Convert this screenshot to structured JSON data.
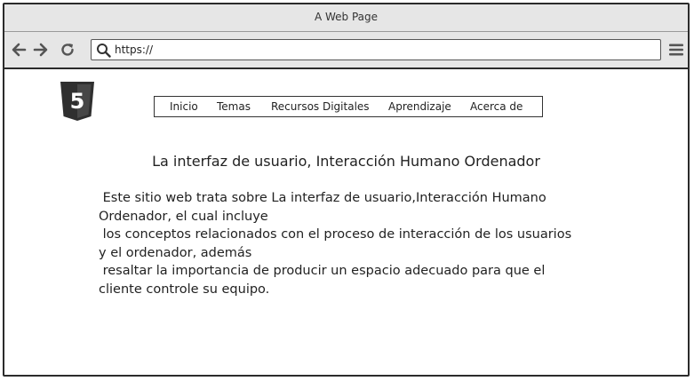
{
  "window": {
    "title": "A Web Page"
  },
  "toolbar": {
    "url": "https://",
    "icons": [
      "back-arrow-icon",
      "forward-arrow-icon",
      "reload-icon",
      "search-icon",
      "hamburger-menu-icon"
    ]
  },
  "logo": {
    "icon": "html5-logo-icon",
    "label": "5"
  },
  "nav": {
    "items": [
      {
        "label": "Inicio"
      },
      {
        "label": "Temas"
      },
      {
        "label": "Recursos Digitales"
      },
      {
        "label": "Aprendizaje"
      },
      {
        "label": "Acerca de"
      }
    ]
  },
  "main": {
    "heading": "La interfaz de usuario, Interacción Humano Ordenador",
    "lines": [
      " Este sitio web trata sobre La interfaz de usuario,Interacción Humano",
      "Ordenador, el cual incluye",
      " los conceptos relacionados con el proceso de interacción de los usuarios",
      "y el ordenador, además",
      " resaltar la importancia de producir un espacio adecuado para que el",
      "cliente controle su equipo."
    ]
  },
  "colors": {
    "chrome": "#e6e6e6",
    "border": "#2b2b2b",
    "icon": "#555555",
    "text": "#222222"
  }
}
